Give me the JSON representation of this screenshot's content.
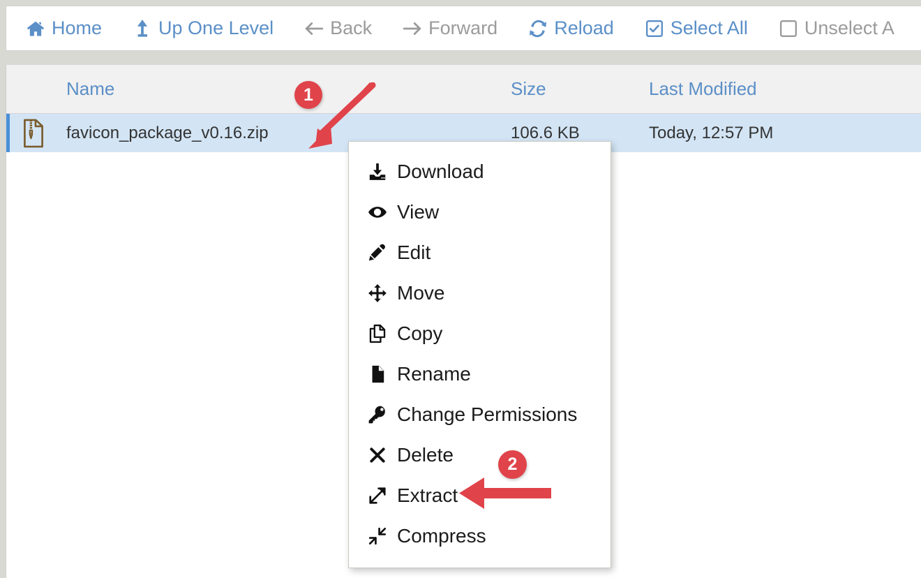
{
  "toolbar": {
    "buttons": [
      {
        "label": "Home",
        "icon": "home-icon",
        "enabled": true
      },
      {
        "label": "Up One Level",
        "icon": "arrow-up-icon",
        "enabled": true
      },
      {
        "label": "Back",
        "icon": "arrow-left-icon",
        "enabled": false
      },
      {
        "label": "Forward",
        "icon": "arrow-right-icon",
        "enabled": false
      },
      {
        "label": "Reload",
        "icon": "reload-icon",
        "enabled": true
      },
      {
        "label": "Select All",
        "icon": "checkbox-checked-icon",
        "enabled": true
      },
      {
        "label": "Unselect A",
        "icon": "checkbox-empty-icon",
        "enabled": false
      }
    ]
  },
  "table": {
    "columns": {
      "name": "Name",
      "size": "Size",
      "modified": "Last Modified"
    },
    "rows": [
      {
        "icon": "zip-file-icon",
        "name": "favicon_package_v0.16.zip",
        "size": "106.6 KB",
        "modified": "Today, 12:57 PM",
        "selected": true
      }
    ]
  },
  "context_menu": {
    "items": [
      {
        "label": "Download",
        "icon": "download-icon"
      },
      {
        "label": "View",
        "icon": "eye-icon"
      },
      {
        "label": "Edit",
        "icon": "pencil-icon"
      },
      {
        "label": "Move",
        "icon": "move-arrows-icon"
      },
      {
        "label": "Copy",
        "icon": "copy-icon"
      },
      {
        "label": "Rename",
        "icon": "file-icon"
      },
      {
        "label": "Change Permissions",
        "icon": "key-icon"
      },
      {
        "label": "Delete",
        "icon": "x-mark-icon"
      },
      {
        "label": "Extract",
        "icon": "expand-arrows-icon"
      },
      {
        "label": "Compress",
        "icon": "contract-arrows-icon"
      }
    ]
  },
  "annotations": [
    {
      "number": "1",
      "target": "file-name-cell"
    },
    {
      "number": "2",
      "target": "context-menu-item-extract"
    }
  ],
  "colors": {
    "accent_blue": "#5b8fc7",
    "selected_row": "#d3e5f5",
    "selected_bar": "#4a90d9",
    "annotation_red": "#e0434a",
    "zip_icon": "#7a5c2e",
    "disabled_text": "#9b9b9b"
  }
}
